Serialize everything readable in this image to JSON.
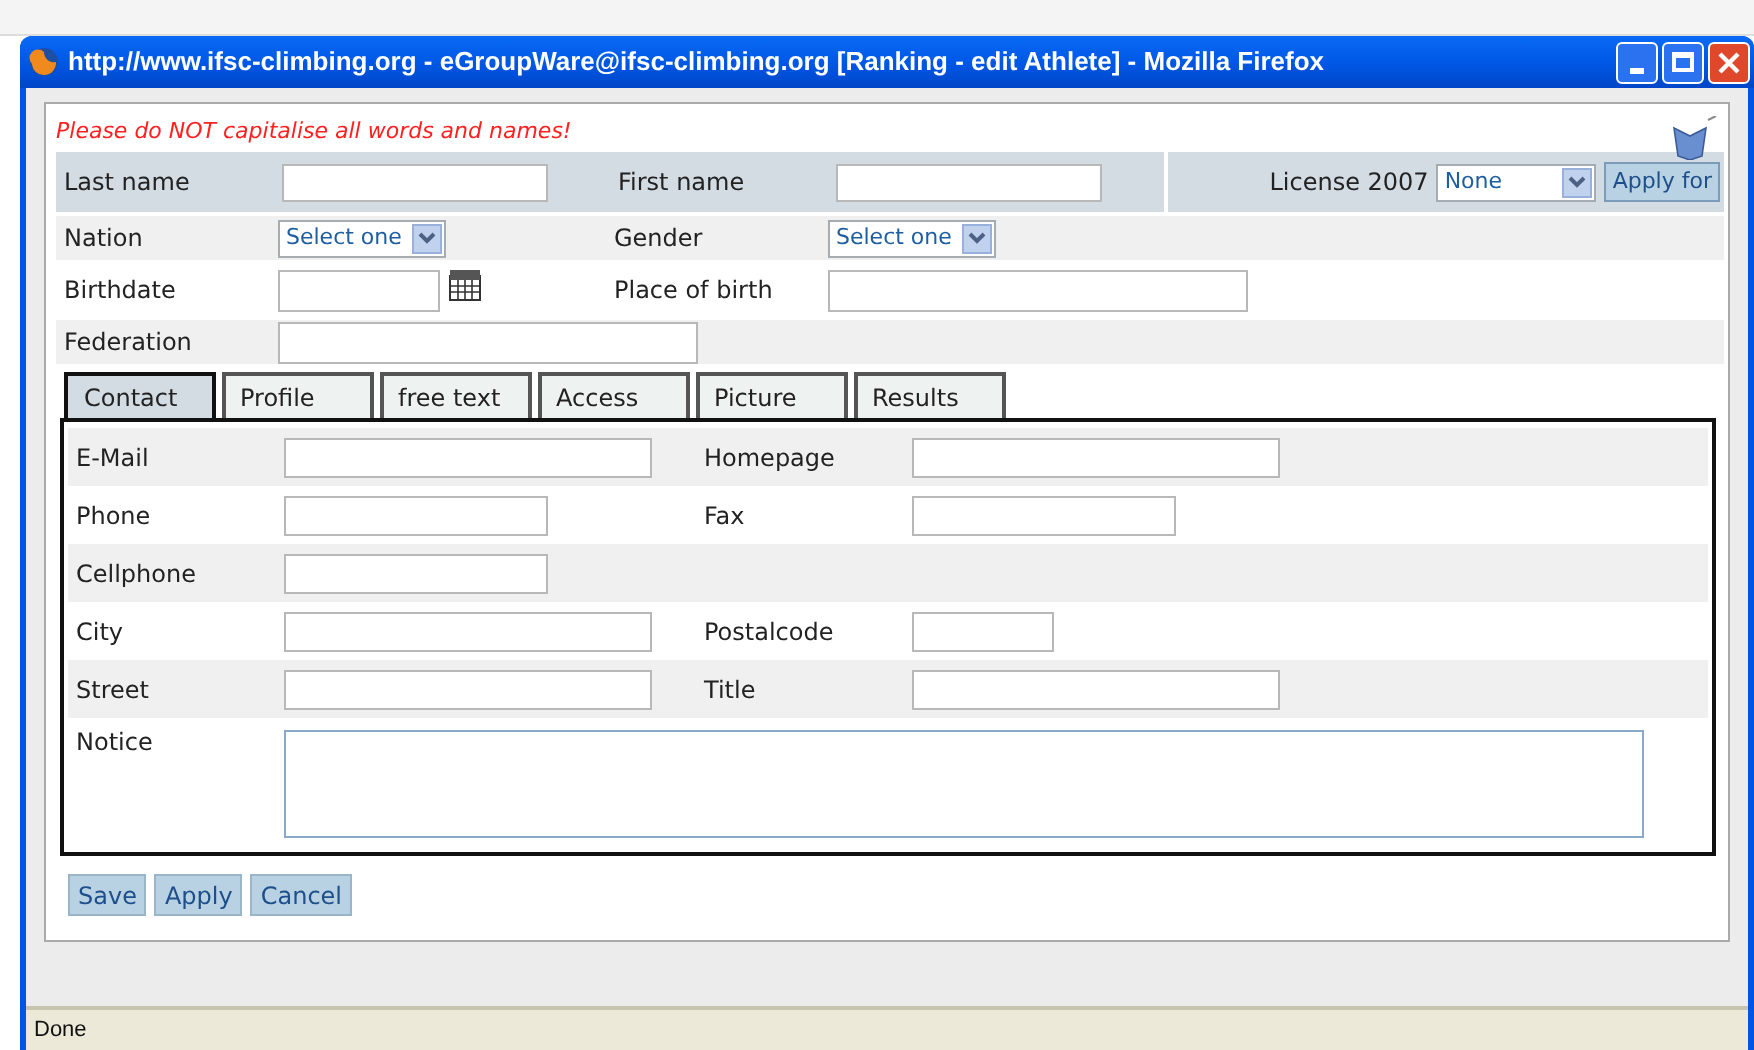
{
  "window": {
    "title": "http://www.ifsc-climbing.org - eGroupWare@ifsc-climbing.org [Ranking - edit Athlete] - Mozilla Firefox"
  },
  "warning": "Please do NOT capitalise all words and names!",
  "header_rows": [
    {
      "fields": [
        {
          "label": "Last name",
          "kind": "text"
        },
        {
          "label": "First name",
          "kind": "text"
        }
      ],
      "license": {
        "label": "License 2007",
        "value": "None",
        "button": "Apply for"
      }
    },
    {
      "fields": [
        {
          "label": "Nation",
          "kind": "select",
          "value": "Select one"
        },
        {
          "label": "Gender",
          "kind": "select",
          "value": "Select one"
        }
      ]
    },
    {
      "fields": [
        {
          "label": "Birthdate",
          "kind": "date"
        },
        {
          "label": "Place of birth",
          "kind": "long"
        }
      ]
    },
    {
      "fields": [
        {
          "label": "Federation",
          "kind": "long"
        }
      ]
    }
  ],
  "tabs": [
    {
      "label": "Contact",
      "selected": true
    },
    {
      "label": "Profile",
      "selected": false
    },
    {
      "label": "free text",
      "selected": false
    },
    {
      "label": "Access",
      "selected": false
    },
    {
      "label": "Picture",
      "selected": false
    },
    {
      "label": "Results",
      "selected": false
    }
  ],
  "contact_rows": [
    [
      {
        "label": "E-Mail",
        "kind": "wide"
      },
      {
        "label": "Homepage",
        "kind": "wide"
      }
    ],
    [
      {
        "label": "Phone",
        "kind": "medium"
      },
      {
        "label": "Fax",
        "kind": "medium"
      }
    ],
    [
      {
        "label": "Cellphone",
        "kind": "medium"
      }
    ],
    [
      {
        "label": "City",
        "kind": "wide"
      },
      {
        "label": "Postalcode",
        "kind": "small"
      }
    ],
    [
      {
        "label": "Street",
        "kind": "wide"
      },
      {
        "label": "Title",
        "kind": "wide"
      }
    ],
    [
      {
        "label": "Notice",
        "kind": "textarea"
      }
    ]
  ],
  "buttons": [
    "Save",
    "Apply",
    "Cancel"
  ],
  "status_bar": "Done"
}
